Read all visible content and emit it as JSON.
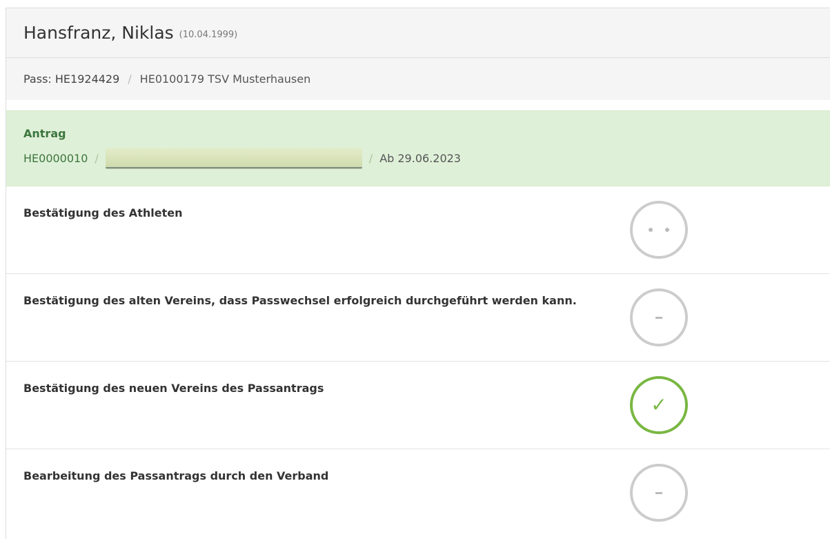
{
  "athlete": {
    "name": "Hansfranz, Niklas",
    "dob": "(10.04.1999)"
  },
  "pass": {
    "label": "Pass: HE1924429",
    "separator": "/",
    "club": "HE0100179 TSV Musterhausen"
  },
  "antrag": {
    "title": "Antrag",
    "code": "HE0000010",
    "separator": "/",
    "date": "Ab 29.06.2023"
  },
  "steps": [
    {
      "label": "Bestätigung des Athleten",
      "status": "pending"
    },
    {
      "label": "Bestätigung des alten Vereins, dass Passwechsel erfolgreich durchgeführt werden kann.",
      "status": "open"
    },
    {
      "label": "Bestätigung des neuen Vereins des Passantrags",
      "status": "done",
      "symbol": "✓"
    },
    {
      "label": "Bearbeitung des Passantrags durch den Verband",
      "status": "open"
    }
  ],
  "colors": {
    "success": "#79b742",
    "neutral": "#cccccc",
    "antrag_bg": "#dff0d8",
    "antrag_text": "#3c763d"
  }
}
